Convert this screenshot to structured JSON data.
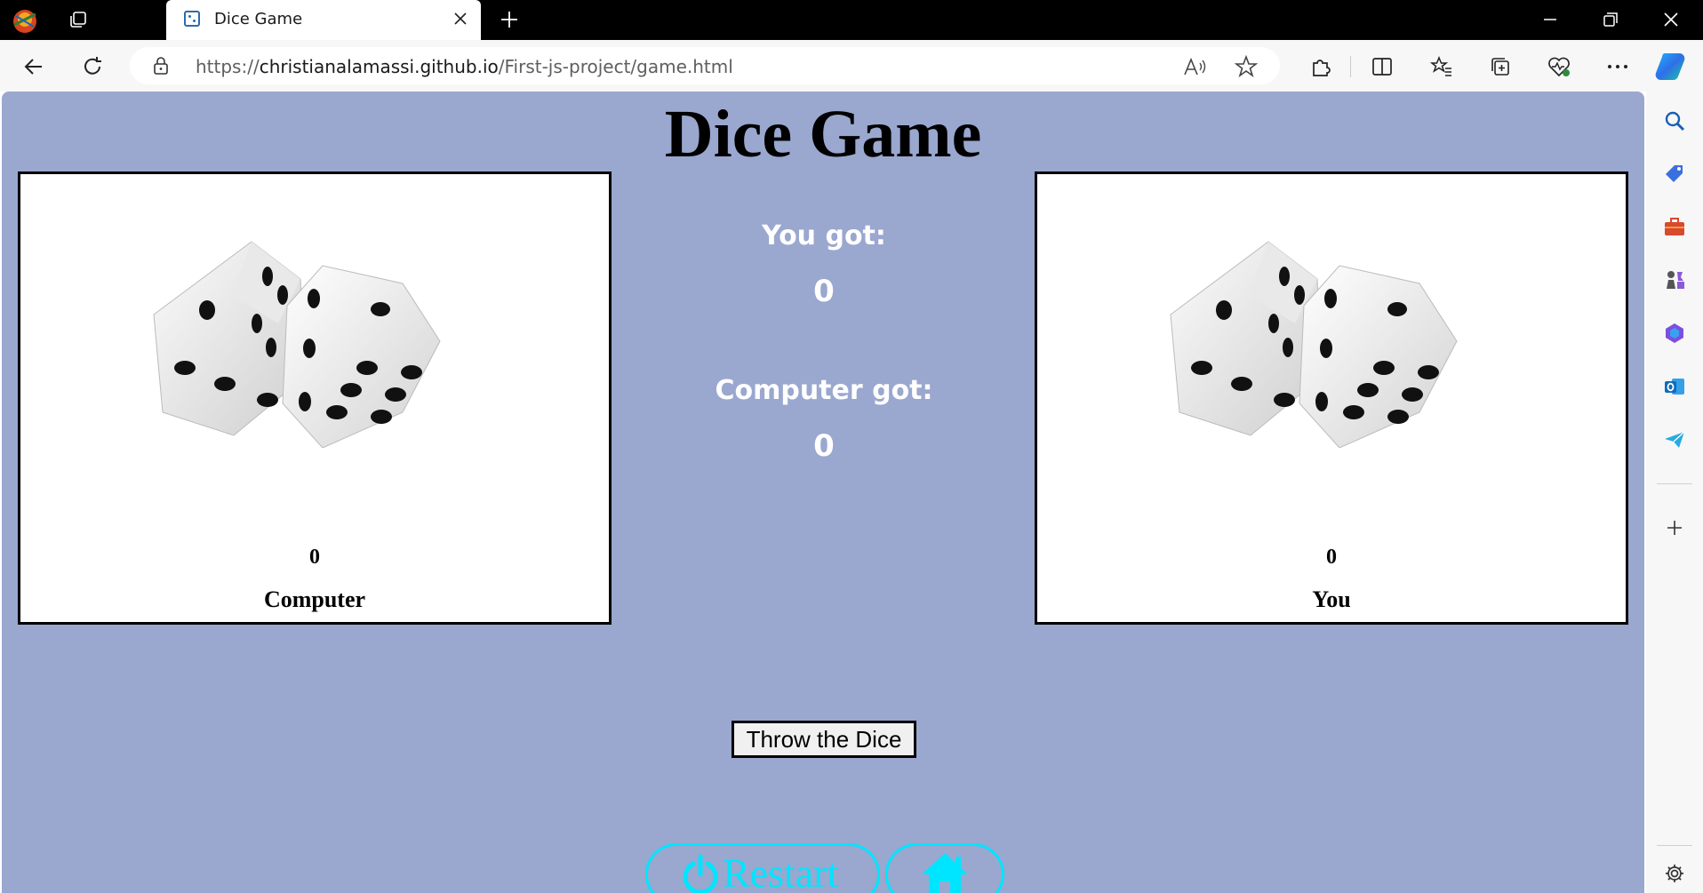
{
  "browser": {
    "tab": {
      "title": "Dice Game"
    },
    "address": {
      "proto": "https://",
      "host": "christianalamassi.github.io",
      "path": "/First-js-project/game.html"
    }
  },
  "game": {
    "title": "Dice Game",
    "computer": {
      "score": "0",
      "name": "Computer"
    },
    "you": {
      "score": "0",
      "name": "You"
    },
    "center": {
      "you_got_label": "You got:",
      "you_got_value": "0",
      "computer_got_label": "Computer got:",
      "computer_got_value": "0"
    },
    "throw_button": "Throw the Dice",
    "restart_button": "Restart"
  },
  "colors": {
    "page_bg": "#9aa7cf",
    "accent_cyan": "#00e5ff"
  }
}
